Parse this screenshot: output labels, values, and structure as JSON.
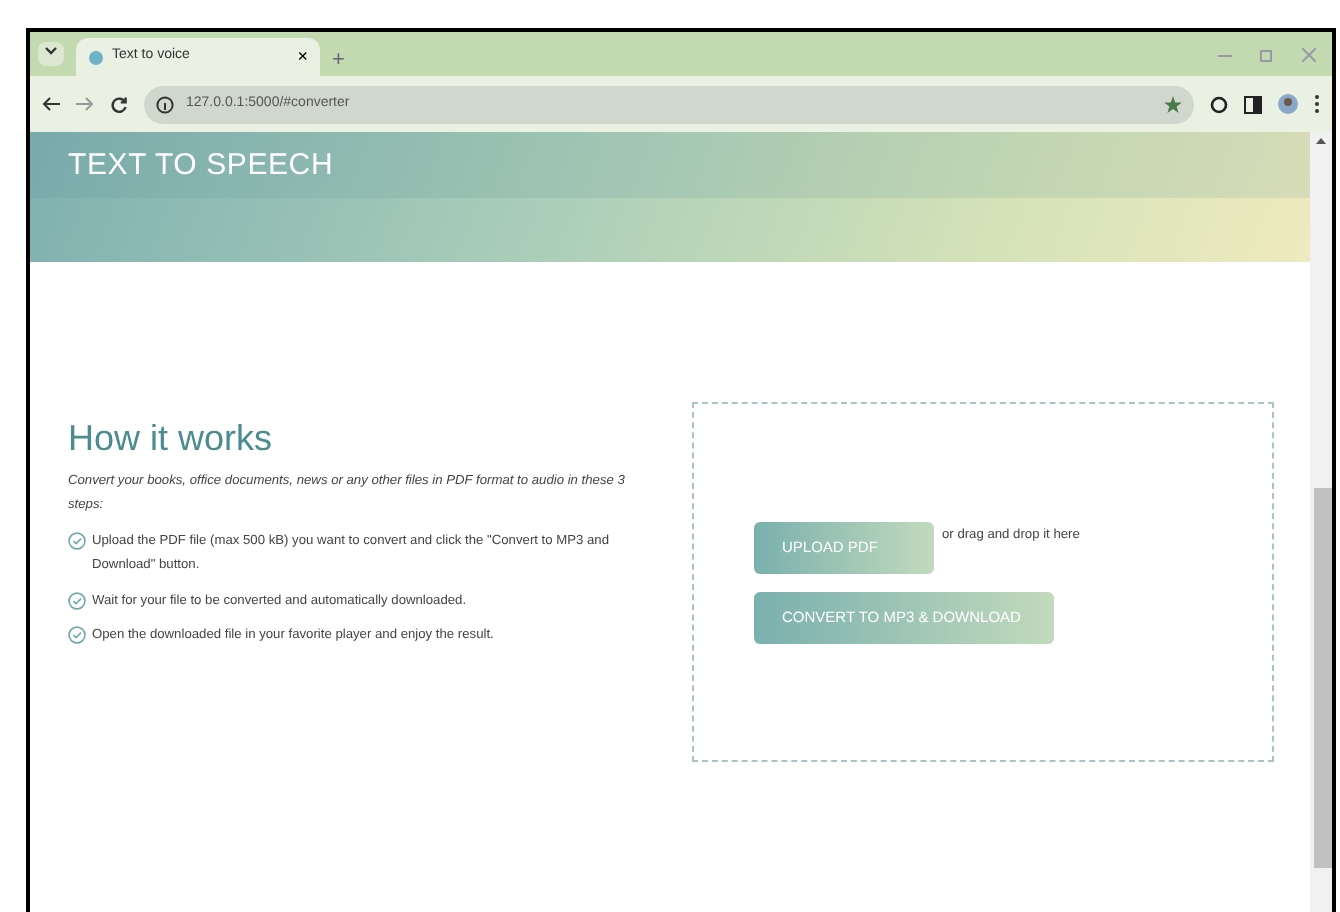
{
  "browser": {
    "tab_title": "Text to voice",
    "tab_close": "×",
    "new_tab": "+",
    "url": "127.0.0.1:5000/#converter"
  },
  "header": {
    "title": "TEXT TO SPEECH"
  },
  "how_it_works": {
    "title": "How it works",
    "intro": "Convert your books, office documents, news or any other files in PDF format to audio in these 3 steps:",
    "steps": [
      "Upload the PDF file (max 500 kB) you want to convert and click the \"Convert to MP3 and Download\" button.",
      "Wait for your file to be converted and automatically downloaded.",
      "Open the downloaded file in your favorite player and enjoy the result."
    ]
  },
  "converter": {
    "upload_button": "UPLOAD PDF",
    "drop_hint": "or drag and drop it here",
    "convert_button": "CONVERT TO MP3 & DOWNLOAD"
  }
}
